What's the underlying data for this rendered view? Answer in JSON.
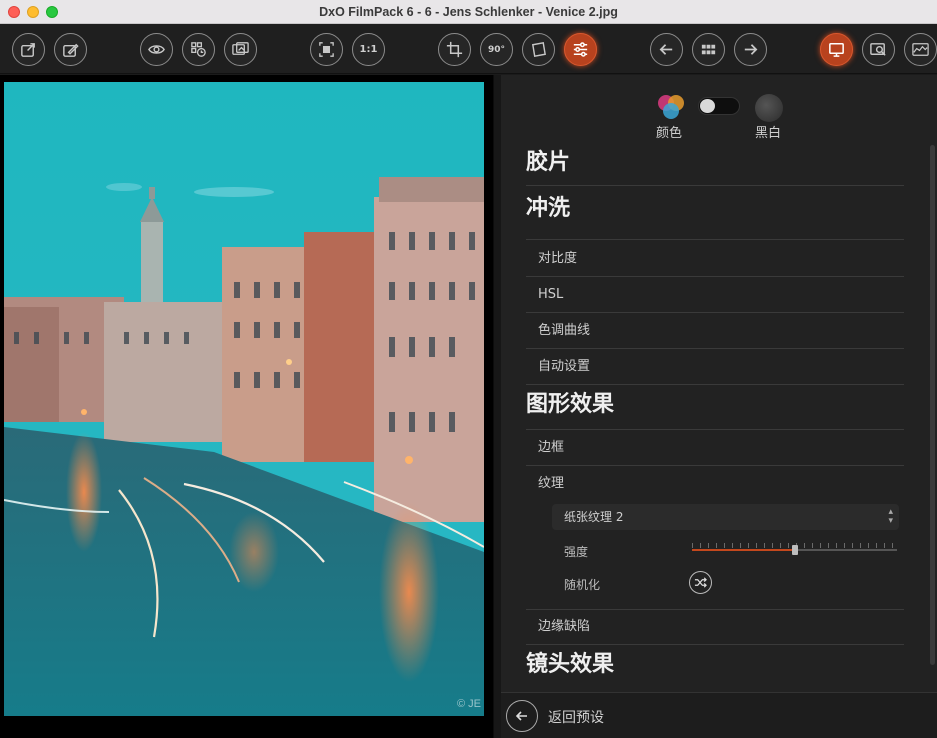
{
  "window": {
    "title": "DxO FilmPack 6 - 6 - Jens Schlenker - Venice 2.jpg"
  },
  "toolbar": {
    "buttons": [
      {
        "id": "export",
        "icon": "export-image-icon"
      },
      {
        "id": "edit-external",
        "icon": "edit-image-icon"
      },
      {
        "id": "preview",
        "icon": "eye-icon"
      },
      {
        "id": "history",
        "icon": "history-grid-icon"
      },
      {
        "id": "compare",
        "icon": "compare-images-icon"
      },
      {
        "id": "fit",
        "icon": "fit-screen-icon"
      },
      {
        "id": "zoom-100",
        "icon": "zoom-actual-icon",
        "label": "1:1"
      },
      {
        "id": "crop",
        "icon": "crop-icon"
      },
      {
        "id": "rotate",
        "icon": "rotate-90-icon",
        "label": "90°"
      },
      {
        "id": "straighten",
        "icon": "straighten-icon"
      },
      {
        "id": "adjust",
        "icon": "sliders-icon",
        "active": true
      },
      {
        "id": "prev",
        "icon": "arrow-left-icon"
      },
      {
        "id": "grid",
        "icon": "grid-icon"
      },
      {
        "id": "next",
        "icon": "arrow-right-icon"
      },
      {
        "id": "display",
        "icon": "monitor-icon",
        "active": true
      },
      {
        "id": "loupe",
        "icon": "loupe-icon"
      },
      {
        "id": "histogram",
        "icon": "histogram-icon"
      }
    ],
    "zoom_label": "1:1",
    "rotate_label": "90°"
  },
  "viewer": {
    "watermark": "© JE"
  },
  "panel": {
    "mode": {
      "color_label": "颜色",
      "bw_label": "黑白",
      "toggle_state": "color"
    },
    "sections": {
      "film": "胶片",
      "develop": "冲洗",
      "graphic": "图形效果",
      "lens": "镜头效果"
    },
    "items": {
      "contrast": "对比度",
      "hsl": "HSL",
      "tone_curve": "色调曲线",
      "auto": "自动设置",
      "frame": "边框",
      "texture": "纹理",
      "edge_defects": "边缘缺陷"
    },
    "texture": {
      "preset": "纸张纹理 2",
      "strength_label": "强度",
      "strength_value": 0.5,
      "randomize_label": "随机化"
    },
    "back_label": "返回预设"
  },
  "colors": {
    "accent": "#c4481d",
    "panel_bg": "#222222"
  }
}
